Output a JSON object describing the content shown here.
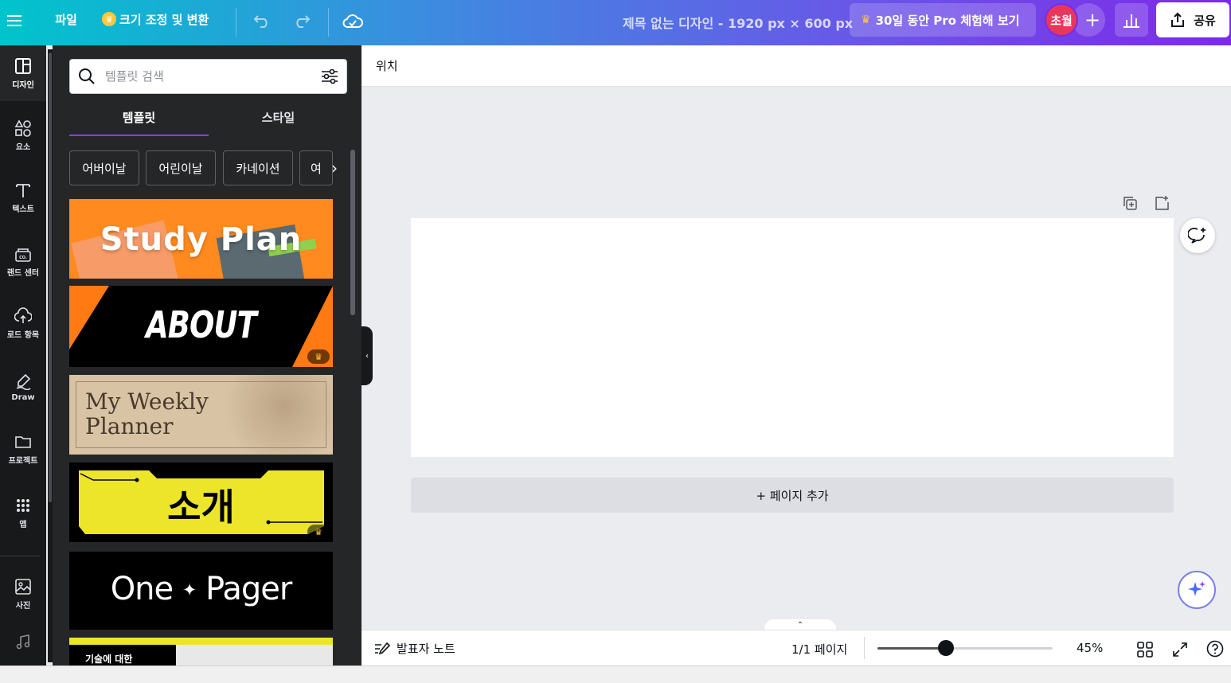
{
  "topbar": {
    "menu_icon": "hamburger-icon",
    "file_label": "파일",
    "resize_label": "크기 조정 및 변환",
    "design_title": "제목 없는 디자인 - 1920 px × 600 px",
    "pro_trial_label": "30일 동안 Pro 체험해 보기",
    "avatar_label": "초월",
    "share_label": "공유"
  },
  "rail": {
    "items": [
      {
        "label": "디자인",
        "icon": "layout-icon"
      },
      {
        "label": "요소",
        "icon": "shapes-icon"
      },
      {
        "label": "텍스트",
        "icon": "text-icon"
      },
      {
        "label": "랜드 센터",
        "icon": "brand-icon"
      },
      {
        "label": "로드 항목",
        "icon": "upload-cloud-icon"
      },
      {
        "label": "Draw",
        "icon": "draw-icon"
      },
      {
        "label": "프로젝트",
        "icon": "folder-icon"
      },
      {
        "label": "앱",
        "icon": "apps-grid-icon"
      },
      {
        "label": "사진",
        "icon": "photo-icon"
      },
      {
        "label": "",
        "icon": "music-icon"
      }
    ]
  },
  "panel": {
    "search_placeholder": "템플릿 검색",
    "tabs": [
      "템플릿",
      "스타일"
    ],
    "chips": [
      "어버이날",
      "어린이날",
      "카네이션",
      "여"
    ],
    "templates": [
      {
        "title": "Study Plan",
        "pro": false
      },
      {
        "title": "ABOUT",
        "pro": true
      },
      {
        "title_line1": "My Weekly",
        "title_line2": "Planner",
        "pro": false
      },
      {
        "title": "소개",
        "pro": true
      },
      {
        "title_left": "One",
        "title_star": "✦",
        "title_right": "Pager",
        "pro": false
      },
      {
        "title": "기술에 대한",
        "pro": false
      }
    ]
  },
  "workspace": {
    "position_label": "위치",
    "add_page_label": "+ 페이지 추가"
  },
  "bottombar": {
    "notes_label": "발표자 노트",
    "page_count": "1/1 페이지",
    "zoom_value": "45%",
    "zoom_fraction": 0.39
  },
  "colors": {
    "accent": "#8b3dff",
    "avatar_bg": "#e8375a",
    "study_plan_bg": "#ff8a1f",
    "about_orange": "#ff7a12",
    "weekly_bg": "#d8c3a5",
    "intro_yellow": "#ece52a"
  }
}
